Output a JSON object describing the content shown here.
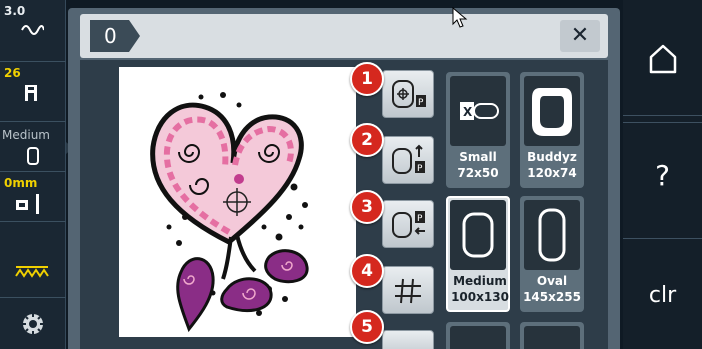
{
  "status_bar": {
    "stitch_length": "3.0",
    "stitch_count": "26",
    "presser_foot": "Medium",
    "offset": "0mm"
  },
  "dialog": {
    "pattern_name": "0",
    "close_label": "✕"
  },
  "tools": {
    "badges": [
      "1",
      "2",
      "3",
      "4",
      "5"
    ],
    "grid_icon": "grid-icon"
  },
  "hoops": [
    {
      "name": "Small",
      "size": "72x50"
    },
    {
      "name": "Buddyz",
      "size": "120x74"
    },
    {
      "name": "Medium",
      "size": "100x130",
      "selected": true
    },
    {
      "name": "Oval",
      "size": "145x255"
    }
  ],
  "right_bar": {
    "help_label": "?",
    "clear_label": "clr"
  },
  "colors": {
    "badge": "#d5281e",
    "accent_yellow": "#f0d000",
    "design_pink": "#e98bb4",
    "design_purple": "#8a2d86"
  }
}
